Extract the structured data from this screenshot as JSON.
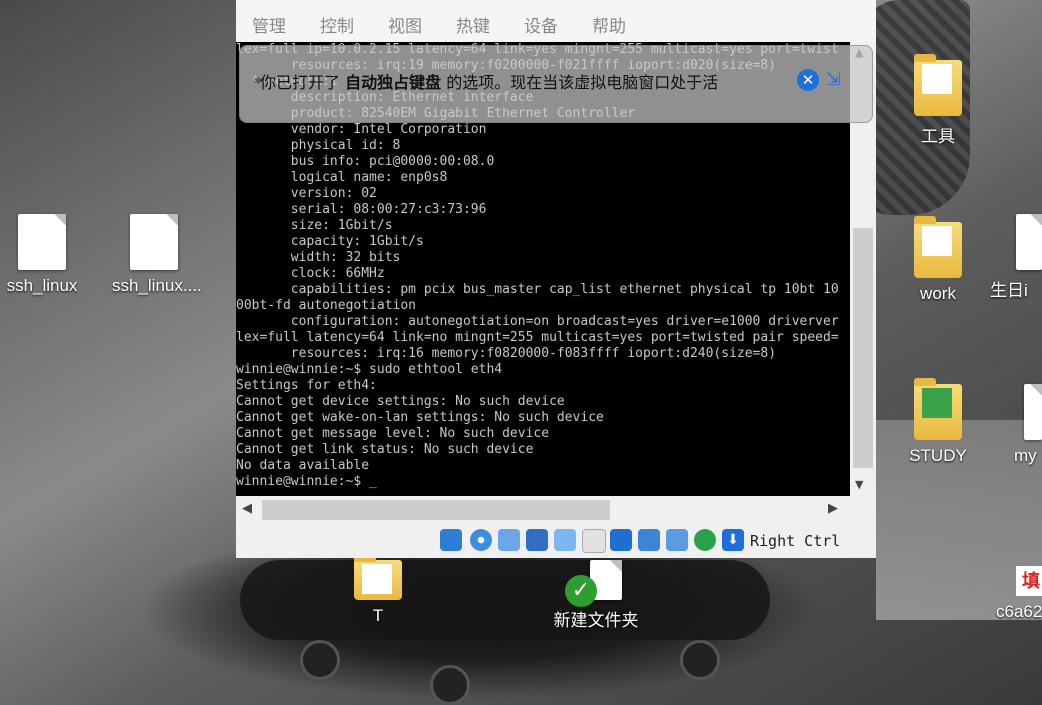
{
  "menu": [
    "管理",
    "控制",
    "视图",
    "热键",
    "设备",
    "帮助"
  ],
  "notification": {
    "prefix": "你已打开了",
    "bold": "自动独占键盘",
    "suffix": "的选项。现在当该虚拟电脑窗口处于活"
  },
  "terminal_lines": [
    "lex=full ip=10.0.2.15 latency=64 link=yes mingnt=255 multicast=yes port=twist",
    "       resources: irq:19 memory:f0200000-f021ffff ioport:d020(size=8)",
    "  *-network:1",
    "       description: Ethernet interface",
    "       product: 82540EM Gigabit Ethernet Controller",
    "       vendor: Intel Corporation",
    "       physical id: 8",
    "       bus info: pci@0000:00:08.0",
    "       logical name: enp0s8",
    "       version: 02",
    "       serial: 08:00:27:c3:73:96",
    "       size: 1Gbit/s",
    "       capacity: 1Gbit/s",
    "       width: 32 bits",
    "       clock: 66MHz",
    "       capabilities: pm pcix bus_master cap_list ethernet physical tp 10bt 10",
    "00bt-fd autonegotiation",
    "       configuration: autonegotiation=on broadcast=yes driver=e1000 driverver",
    "lex=full latency=64 link=no mingnt=255 multicast=yes port=twisted pair speed=",
    "       resources: irq:16 memory:f0820000-f083ffff ioport:d240(size=8)",
    "winnie@winnie:~$ sudo ethtool eth4",
    "Settings for eth4:",
    "Cannot get device settings: No such device",
    "Cannot get wake-on-lan settings: No such device",
    "Cannot get message level: No such device",
    "Cannot get link status: No such device",
    "No data available",
    "winnie@winnie:~$ _"
  ],
  "host_key": "Right Ctrl",
  "desktop_icons": {
    "ssh1": "ssh_linux",
    "ssh2": "ssh_linux....",
    "tools": "工具",
    "work": "work",
    "birthday": "生日i",
    "study": "STUDY",
    "my": "my",
    "t": "T",
    "new_folder": "新建文件夹",
    "c6a": "c6a62",
    "fill": "填"
  },
  "colors": {
    "terminal_bg": "#000000",
    "terminal_fg": "#c8c8c8",
    "accent": "#1e6fd9"
  }
}
